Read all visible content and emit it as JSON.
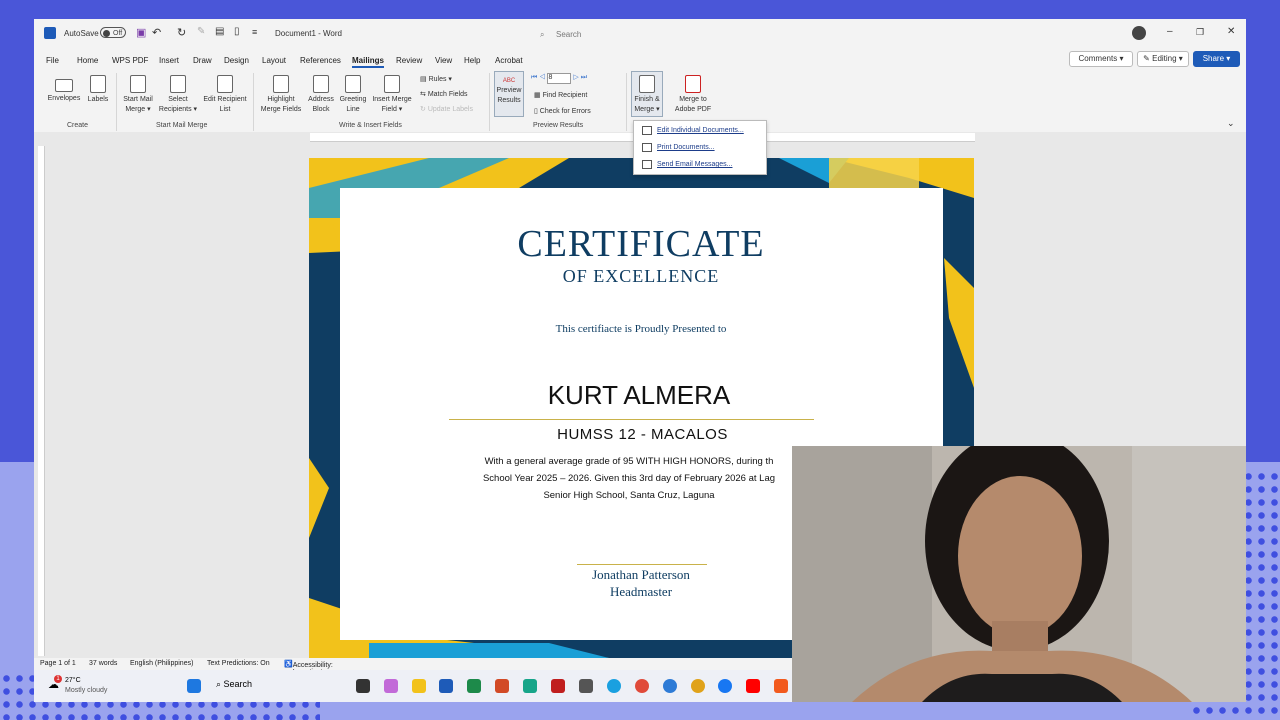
{
  "titlebar": {
    "autosave_label": "AutoSave",
    "autosave_state": "Off",
    "document_name": "Document1 - Word",
    "search_placeholder": "Search"
  },
  "menu": {
    "items": [
      "File",
      "Home",
      "WPS PDF",
      "Insert",
      "Draw",
      "Design",
      "Layout",
      "References",
      "Mailings",
      "Review",
      "View",
      "Help",
      "Acrobat"
    ],
    "active": "Mailings",
    "comments_label": "Comments",
    "editing_label": "Editing",
    "share_label": "Share"
  },
  "ribbon": {
    "envelopes": "Envelopes",
    "labels": "Labels",
    "start_mail_merge": "Start Mail Merge",
    "select_recipients": "Select Recipients",
    "edit_recipient_list": "Edit Recipient List",
    "highlight_merge_fields": "Highlight Merge Fields",
    "address_block": "Address Block",
    "greeting_line": "Greeting Line",
    "insert_merge_field": "Insert Merge Field",
    "rules": "Rules",
    "match_fields": "Match Fields",
    "update_labels": "Update Labels",
    "preview_results": "Preview Results",
    "record_number": "8",
    "find_recipient": "Find Recipient",
    "check_for_errors": "Check for Errors",
    "finish_merge": "Finish & Merge",
    "merge_to_pdf": "Merge to Adobe PDF",
    "groups": {
      "create": "Create",
      "start_mail_merge": "Start Mail Merge",
      "write_insert": "Write & Insert Fields",
      "preview_results": "Preview Results"
    }
  },
  "finish_menu": {
    "items": [
      "Edit Individual Documents...",
      "Print Documents...",
      "Send Email Messages..."
    ]
  },
  "certificate": {
    "title": "CERTIFICATE",
    "subtitle": "OF EXCELLENCE",
    "presented": "This certifiacte is Proudly Presented to",
    "name": "KURT ALMERA",
    "section": "HUMSS 12 - MACALOS",
    "body_line1": "With a general average grade of 95 WITH HIGH HONORS, during th",
    "body_line2": "School Year  2025 – 2026. Given this 3rd day of February 2026 at Lag",
    "body_line3": "Senior High School, Santa Cruz, Laguna",
    "signer": "Jonathan Patterson",
    "signer_role": "Headmaster"
  },
  "statusbar": {
    "page": "Page 1 of 1",
    "words": "37 words",
    "language": "English (Philippines)",
    "text_predictions": "Text Predictions: On",
    "accessibility": "Accessibility: Investigate"
  },
  "taskbar": {
    "weather_temp": "27°C",
    "weather_desc": "Mostly cloudy",
    "weather_badge": "1",
    "search_label": "Search"
  },
  "colors": {
    "accent": "#1e5bb8",
    "navy": "#0f3d62",
    "gold": "#f2c21b",
    "frame": "#4a56d8"
  }
}
